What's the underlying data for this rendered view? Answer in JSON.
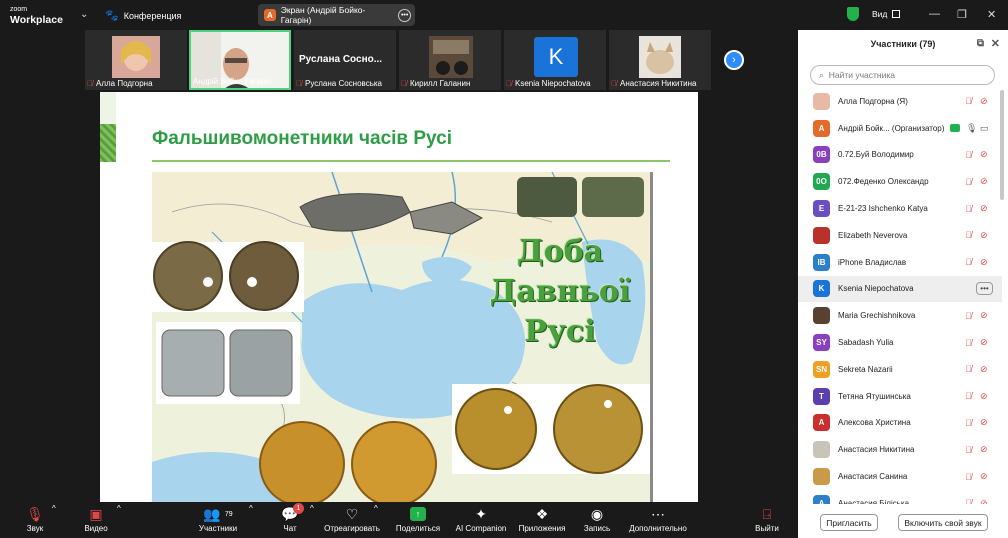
{
  "app": {
    "logo_line1": "zoom",
    "logo_line2": "Workplace",
    "meeting_label": "Конференция",
    "screen_tab_badge": "А",
    "screen_tab_title": "Экран (Андрій Бойко-Гагарін)",
    "view_label": "Вид"
  },
  "gallery": [
    {
      "name": "Алла Подгорна",
      "muted": true
    },
    {
      "name": "Андрій Бойко-Гагарін",
      "muted": false,
      "active": true
    },
    {
      "name": "Руслана Сосновська",
      "muted": true,
      "big_name": "Руслана Сосно..."
    },
    {
      "name": "Кирилл Галанин",
      "muted": true
    },
    {
      "name": "Ksenia Niepochatova",
      "muted": true,
      "initial": "K"
    },
    {
      "name": "Анастасия Никитина",
      "muted": true
    }
  ],
  "slide": {
    "title": "Фальшивомонетники часів Русі",
    "era_line1": "Доба",
    "era_line2": "Давньої",
    "era_line3": "Русі"
  },
  "toolbar": [
    {
      "id": "audio",
      "label": "Звук",
      "icon": "mic-off-icon"
    },
    {
      "id": "video",
      "label": "Видео",
      "icon": "camera-off-icon"
    },
    {
      "id": "participants",
      "label": "Участники",
      "icon": "people-icon",
      "count": "79"
    },
    {
      "id": "chat",
      "label": "Чат",
      "icon": "chat-icon",
      "badge": "1"
    },
    {
      "id": "react",
      "label": "Отреагировать",
      "icon": "heart-icon"
    },
    {
      "id": "share",
      "label": "Поделиться",
      "icon": "share-screen-icon"
    },
    {
      "id": "ai",
      "label": "AI Companion",
      "icon": "sparkle-icon"
    },
    {
      "id": "apps",
      "label": "Приложения",
      "icon": "apps-icon"
    },
    {
      "id": "record",
      "label": "Запись",
      "icon": "record-icon"
    },
    {
      "id": "more",
      "label": "Дополнительно",
      "icon": "more-icon"
    },
    {
      "id": "leave",
      "label": "Выйти",
      "icon": "leave-icon"
    }
  ],
  "participants_panel": {
    "title": "Участники (79)",
    "search_placeholder": "Найти участника",
    "invite_label": "Пригласить",
    "unmute_label": "Включить свой звук",
    "rows": [
      {
        "name": "Алла Подгорна (Я)",
        "avatar": "",
        "color": "#e9b9a8",
        "photo": true
      },
      {
        "name": "Андрій Бойк... (Организатор)",
        "avatar": "А",
        "color": "#e36a2a"
      },
      {
        "name": "0.72.Буй Володимир",
        "avatar": "0B",
        "color": "#8a3fbf"
      },
      {
        "name": "072.Феденко Олександр",
        "avatar": "0O",
        "color": "#22a850"
      },
      {
        "name": "E-21-23 Ishchenko Katya",
        "avatar": "E",
        "color": "#6b4fc2"
      },
      {
        "name": "Elizabeth Neverova",
        "avatar": "",
        "color": "#b8322b",
        "photo": true
      },
      {
        "name": "iPhone Владислав",
        "avatar": "IB",
        "color": "#2d7fc9"
      },
      {
        "name": "Ksenia Niepochatova",
        "avatar": "K",
        "color": "#1a73d9",
        "highlight": true
      },
      {
        "name": "Maria Grechishnikova",
        "avatar": "",
        "color": "#5a4030",
        "photo": true
      },
      {
        "name": "Sabadash Yulia",
        "avatar": "SY",
        "color": "#8a3fbf"
      },
      {
        "name": "Sekreta Nazarii",
        "avatar": "SN",
        "color": "#f0a020"
      },
      {
        "name": "Тетяна Ятушинська",
        "avatar": "T",
        "color": "#5b3fb0"
      },
      {
        "name": "Алексова Христина",
        "avatar": "A",
        "color": "#cc2d2d"
      },
      {
        "name": "Анастасия Никитина",
        "avatar": "",
        "color": "#c9c3b8",
        "photo": true
      },
      {
        "name": "Анастасия Санина",
        "avatar": "",
        "color": "#c99a4a",
        "photo": true
      },
      {
        "name": "Анастасия Біліська",
        "avatar": "A",
        "color": "#2d7fc9"
      }
    ]
  }
}
